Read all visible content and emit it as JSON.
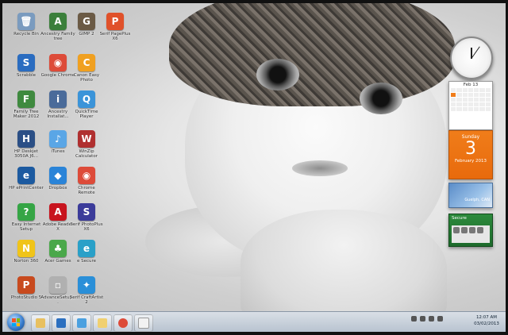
{
  "desktop": {
    "icons": [
      {
        "label": "Recycle Bin",
        "color": "#7a9bbf",
        "glyph": "🗑",
        "icon": "recycle-bin-icon"
      },
      {
        "label": "Ancestry Family tree",
        "color": "#3b7f3b",
        "glyph": "A",
        "icon": "ancestry-icon"
      },
      {
        "label": "GIMP 2",
        "color": "#6b5a45",
        "glyph": "G",
        "icon": "gimp-icon"
      },
      {
        "label": "Serif PagePlus X6",
        "color": "#e0512a",
        "glyph": "P",
        "icon": "pageplus-icon"
      },
      {
        "label": "Scrabble",
        "color": "#2a6cc0",
        "glyph": "S",
        "icon": "scrabble-icon"
      },
      {
        "label": "Google Chrome",
        "color": "#dd4b39",
        "glyph": "◉",
        "icon": "chrome-icon"
      },
      {
        "label": "Canon Easy Photo",
        "color": "#f0a020",
        "glyph": "C",
        "icon": "photo-app-icon"
      },
      {
        "label": "Family Tree Maker 2012",
        "color": "#3f8a3f",
        "glyph": "F",
        "icon": "family-tree-icon"
      },
      {
        "label": "Ancestry Installat...",
        "color": "#4a6b9a",
        "glyph": "i",
        "icon": "installer-icon"
      },
      {
        "label": "QuickTime Player",
        "color": "#3b94d9",
        "glyph": "Q",
        "icon": "quicktime-icon"
      },
      {
        "label": "HP Deskjet 3050A J6...",
        "color": "#2b4f86",
        "glyph": "H",
        "icon": "printer-icon"
      },
      {
        "label": "iTunes",
        "color": "#5aa6e6",
        "glyph": "♪",
        "icon": "itunes-icon"
      },
      {
        "label": "WinZip Calculator",
        "color": "#b03030",
        "glyph": "W",
        "icon": "winzip-icon"
      },
      {
        "label": "HP ePrintCenter",
        "color": "#1c5aa0",
        "glyph": "e",
        "icon": "eprint-icon"
      },
      {
        "label": "Dropbox",
        "color": "#2a84d8",
        "glyph": "◆",
        "icon": "dropbox-icon"
      },
      {
        "label": "Chrome Remote",
        "color": "#dd4b39",
        "glyph": "◉",
        "icon": "remote-chrome-icon"
      },
      {
        "label": "Easy Internet Setup",
        "color": "#35a545",
        "glyph": "?",
        "icon": "help-icon"
      },
      {
        "label": "Adobe Reader X",
        "color": "#c8141e",
        "glyph": "A",
        "icon": "adobe-reader-icon"
      },
      {
        "label": "Serif PhotoPlus X6",
        "color": "#3b3b9a",
        "glyph": "S",
        "icon": "photoplus-icon"
      },
      {
        "label": "Norton 360",
        "color": "#f0c419",
        "glyph": "N",
        "icon": "norton-icon"
      },
      {
        "label": "Acer Games",
        "color": "#4aa84a",
        "glyph": "♣",
        "icon": "games-icon"
      },
      {
        "label": "e Secure",
        "color": "#2aa0c8",
        "glyph": "e",
        "icon": "esecure-icon"
      },
      {
        "label": "PhotoStudio 5",
        "color": "#c84a1e",
        "glyph": "P",
        "icon": "photostudio-icon"
      },
      {
        "label": "AdvanceSetup...",
        "color": "#b0b0b0",
        "glyph": "▫",
        "icon": "document-icon"
      },
      {
        "label": "Serif CraftArtist 2",
        "color": "#2a8fd8",
        "glyph": "✦",
        "icon": "craftartist-icon"
      }
    ]
  },
  "gadgets": {
    "calendar_month_header": "Feb 13",
    "calendar_day_name": "Sunday",
    "calendar_day_number": "3",
    "calendar_month_year": "February 2013",
    "weather_location": "Guelph, CAN",
    "security_title": "Secure"
  },
  "taskbar": {
    "time": "12:07 AM",
    "date": "03/02/2013",
    "pinned": [
      "explorer-icon",
      "media-icon",
      "paint-icon",
      "folder-icon",
      "chrome-icon",
      "document-icon"
    ]
  },
  "colors": {
    "taskbar": "#c6cfd9",
    "accent_orange": "#f07d1a",
    "secure_green": "#2c8a3c"
  }
}
